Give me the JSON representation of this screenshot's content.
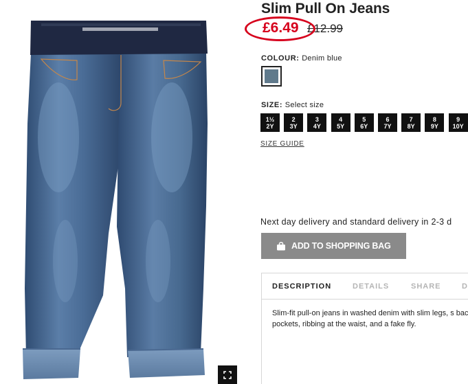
{
  "product": {
    "title": "Slim Pull On Jeans",
    "sale_price": "£6.49",
    "original_price": "£12.99",
    "price_highlight_color": "#d6001c"
  },
  "colour": {
    "label": "COLOUR:",
    "value": "Denim blue",
    "swatch_color": "#607a8c"
  },
  "size": {
    "label": "SIZE:",
    "value": "Select size",
    "options": [
      "1½\n2Y",
      "2\n3Y",
      "3\n4Y",
      "4\n5Y",
      "5\n6Y",
      "6\n7Y",
      "7\n8Y",
      "8\n9Y",
      "9\n10Y"
    ],
    "guide_label": "SIZE GUIDE"
  },
  "delivery": {
    "text": "Next day delivery and standard delivery in 2-3 d"
  },
  "actions": {
    "add_to_bag_label": "ADD TO SHOPPING BAG",
    "add_to_bag_icon": "shopping-bag-icon",
    "fullscreen_icon": "fullscreen-icon"
  },
  "tabs": [
    {
      "label": "DESCRIPTION",
      "active": true
    },
    {
      "label": "DETAILS",
      "active": false
    },
    {
      "label": "SHARE",
      "active": false
    },
    {
      "label": "D",
      "active": false
    }
  ],
  "description": {
    "text": "Slim-fit pull-on jeans in washed denim with slim legs, s back pockets, ribbing at the waist, and a fake fly."
  }
}
